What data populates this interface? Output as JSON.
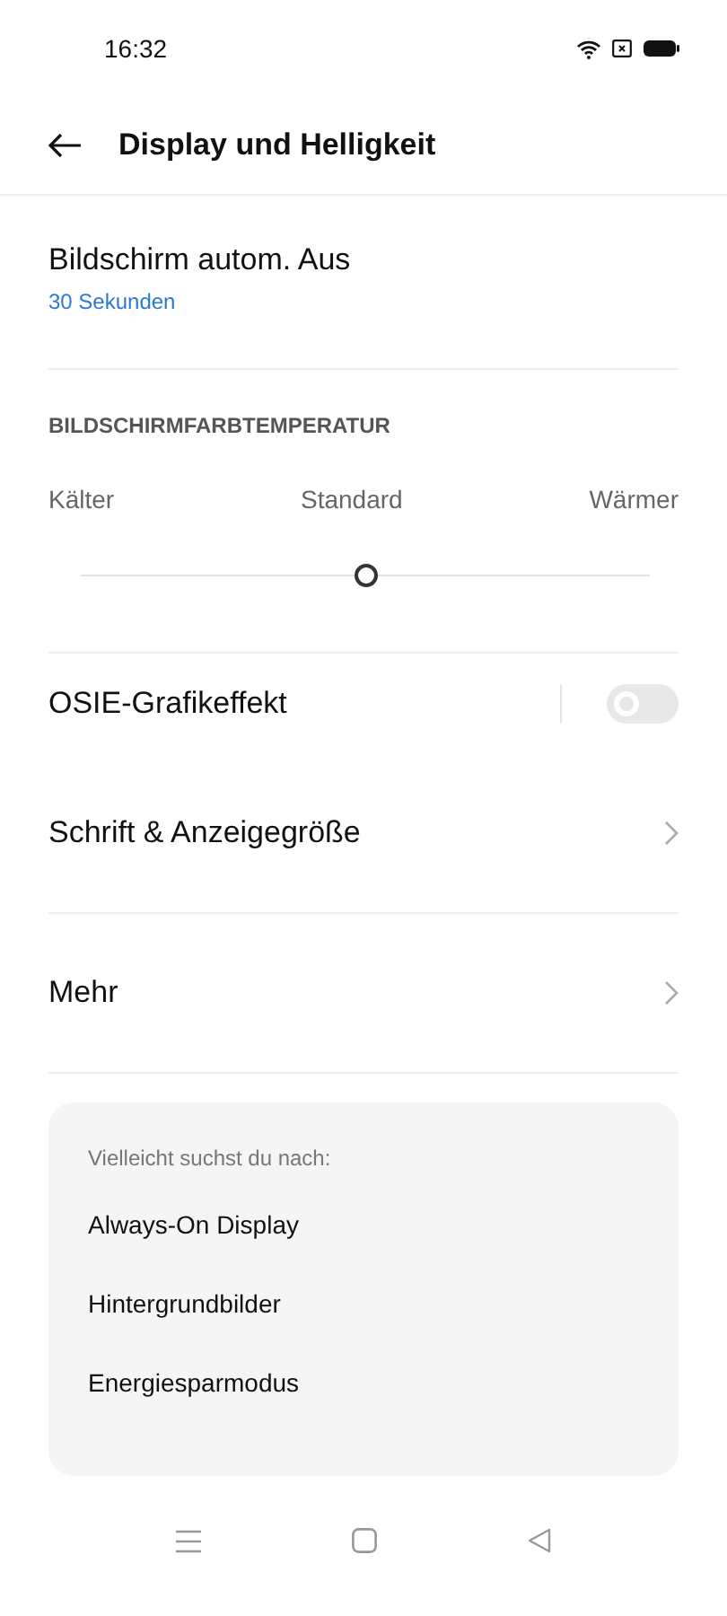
{
  "status_bar": {
    "time": "16:32"
  },
  "header": {
    "title": "Display und Helligkeit"
  },
  "screen_off": {
    "title": "Bildschirm autom. Aus",
    "value": "30 Sekunden"
  },
  "color_temperature": {
    "heading": "BILDSCHIRMFARBTEMPERATUR",
    "labels": [
      "Kälter",
      "Standard",
      "Wärmer"
    ],
    "level": 0.5
  },
  "items": [
    {
      "kind": "toggle",
      "label": "OSIE-Grafikeffekt",
      "on": false,
      "divider_after": false
    },
    {
      "kind": "link",
      "label": "Schrift & Anzeigegröße",
      "divider_after": true
    },
    {
      "kind": "link",
      "label": "Mehr",
      "divider_after": true
    }
  ],
  "suggestions": {
    "heading": "Vielleicht suchst du nach:",
    "items": [
      "Always-On Display",
      "Hintergrundbilder",
      "Energiesparmodus"
    ]
  }
}
